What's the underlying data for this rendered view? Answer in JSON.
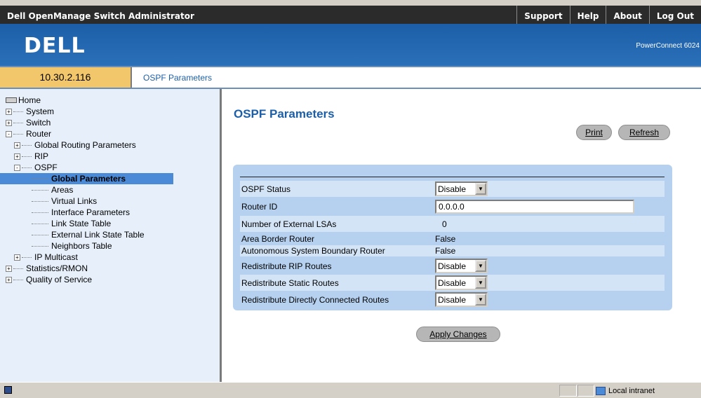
{
  "header": {
    "app_title": "Dell OpenManage Switch Administrator",
    "nav": [
      "Support",
      "Help",
      "About",
      "Log Out"
    ]
  },
  "brand": {
    "logo": "DELL",
    "product": "PowerConnect 6024"
  },
  "address": {
    "ip": "10.30.2.116",
    "breadcrumb": "OSPF Parameters"
  },
  "tree": [
    {
      "label": "Home",
      "level": 0,
      "icon": "home-icon"
    },
    {
      "label": "System",
      "level": 1,
      "expander": "+"
    },
    {
      "label": "Switch",
      "level": 1,
      "expander": "+"
    },
    {
      "label": "Router",
      "level": 1,
      "expander": "-"
    },
    {
      "label": "Global Routing Parameters",
      "level": 2,
      "expander": "+"
    },
    {
      "label": "RIP",
      "level": 2,
      "expander": "+"
    },
    {
      "label": "OSPF",
      "level": 2,
      "expander": "-"
    },
    {
      "label": "Global Parameters",
      "level": 3,
      "selected": true
    },
    {
      "label": "Areas",
      "level": 3
    },
    {
      "label": "Virtual Links",
      "level": 3
    },
    {
      "label": "Interface Parameters",
      "level": 3
    },
    {
      "label": "Link State Table",
      "level": 3
    },
    {
      "label": "External Link State Table",
      "level": 3
    },
    {
      "label": "Neighbors Table",
      "level": 3
    },
    {
      "label": "IP Multicast",
      "level": 2,
      "expander": "+"
    },
    {
      "label": "Statistics/RMON",
      "level": 1,
      "expander": "+"
    },
    {
      "label": "Quality of Service",
      "level": 1,
      "expander": "+"
    }
  ],
  "page": {
    "title": "OSPF Parameters",
    "print_label": "Print",
    "refresh_label": "Refresh",
    "apply_label": "Apply Changes"
  },
  "form": {
    "ospf_status": {
      "label": "OSPF Status",
      "value": "Disable"
    },
    "router_id": {
      "label": "Router ID",
      "value": "0.0.0.0"
    },
    "external_lsas": {
      "label": "Number of External LSAs",
      "value": "0"
    },
    "area_border_router": {
      "label": "Area Border Router",
      "value": "False"
    },
    "as_boundary_router": {
      "label": "Autonomous System Boundary Router",
      "value": "False"
    },
    "redistribute_rip": {
      "label": "Redistribute RIP Routes",
      "value": "Disable"
    },
    "redistribute_static": {
      "label": "Redistribute Static Routes",
      "value": "Disable"
    },
    "redistribute_connected": {
      "label": "Redistribute Directly Connected Routes",
      "value": "Disable"
    }
  },
  "status_bar": {
    "zone": "Local intranet"
  },
  "colors": {
    "header_bg": "#2b2b2b",
    "brand_blue": "#1c5fa8",
    "ip_box": "#f2c76c",
    "tree_bg": "#e6effa",
    "tree_selected": "#4a8ad6",
    "form_bg": "#b5d1ef"
  }
}
